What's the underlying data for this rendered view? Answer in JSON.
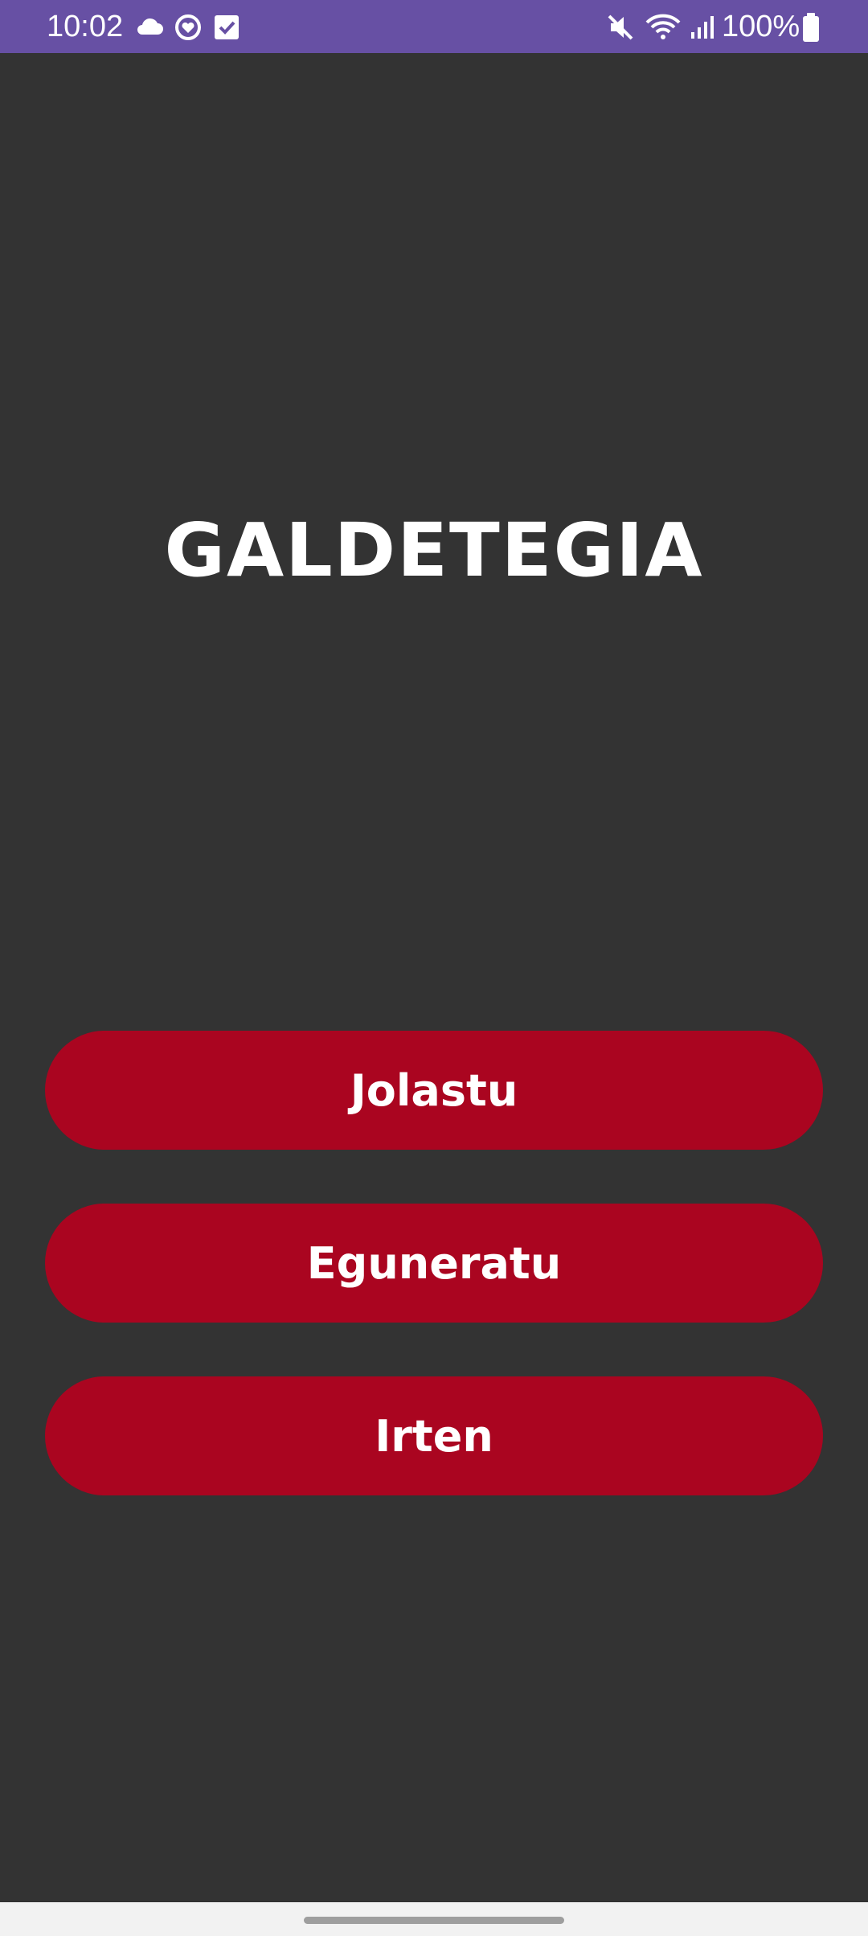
{
  "status_bar": {
    "time": "10:02",
    "battery_percent": "100%",
    "background_color": "#6750A4",
    "icons": [
      "cloud-icon",
      "heart-sync-icon",
      "checkbox-icon",
      "mute-icon",
      "wifi-icon",
      "signal-icon",
      "battery-icon"
    ]
  },
  "main": {
    "title": "GALDETEGIA",
    "buttons": [
      {
        "label": "Jolastu"
      },
      {
        "label": "Eguneratu"
      },
      {
        "label": "Irten"
      }
    ],
    "background_color": "#333333",
    "button_color": "#AA0520"
  }
}
